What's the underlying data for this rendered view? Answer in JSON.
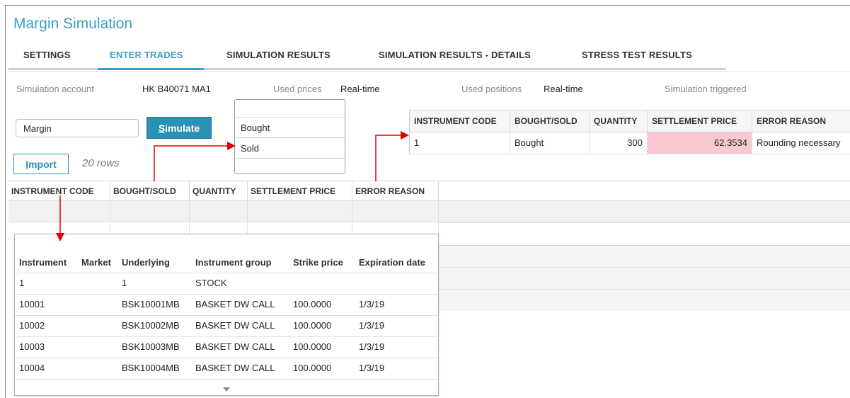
{
  "app": {
    "title": "Margin Simulation"
  },
  "tabs": [
    {
      "label": "SETTINGS"
    },
    {
      "label": "ENTER TRADES"
    },
    {
      "label": "SIMULATION RESULTS"
    },
    {
      "label": "SIMULATION RESULTS - DETAILS"
    },
    {
      "label": "STRESS TEST RESULTS"
    }
  ],
  "info": {
    "account_label": "Simulation account",
    "account_value": "HK B40071 MA1",
    "prices_label": "Used prices",
    "prices_value": "Real-time",
    "positions_label": "Used positions",
    "positions_value": "Real-time",
    "triggered_label": "Simulation triggered"
  },
  "controls": {
    "input_value": "Margin",
    "simulate_label": "Simulate",
    "simulate_mnemonic": "S",
    "simulate_rest": "imulate",
    "import_mnemonic": "I",
    "import_rest": "mport",
    "rows_count": "20 rows"
  },
  "dropdown": {
    "options": [
      "Bought",
      "Sold"
    ]
  },
  "main_grid": {
    "headers": [
      "INSTRUMENT CODE",
      "BOUGHT/SOLD",
      "QUANTITY",
      "SETTLEMENT PRICE",
      "ERROR REASON"
    ]
  },
  "error_table": {
    "headers": [
      "INSTRUMENT CODE",
      "BOUGHT/SOLD",
      "QUANTITY",
      "SETTLEMENT PRICE",
      "ERROR REASON"
    ],
    "row": {
      "instrument": "1",
      "bought_sold": "Bought",
      "quantity": "300",
      "settlement_price": "62.3534",
      "error_reason": "Rounding necessary"
    }
  },
  "instrument_popup": {
    "headers": [
      "Instrument",
      "Market",
      "Underlying",
      "Instrument group",
      "Strike price",
      "Expiration date"
    ],
    "rows": [
      {
        "instrument": "1",
        "market": "",
        "underlying": "1",
        "group": "STOCK",
        "strike": "",
        "expiration": ""
      },
      {
        "instrument": "10001",
        "market": "",
        "underlying": "BSK10001MB",
        "group": "BASKET DW CALL",
        "strike": "100.0000",
        "expiration": "1/3/19"
      },
      {
        "instrument": "10002",
        "market": "",
        "underlying": "BSK10002MB",
        "group": "BASKET DW CALL",
        "strike": "100.0000",
        "expiration": "1/3/19"
      },
      {
        "instrument": "10003",
        "market": "",
        "underlying": "BSK10003MB",
        "group": "BASKET DW CALL",
        "strike": "100.0000",
        "expiration": "1/3/19"
      },
      {
        "instrument": "10004",
        "market": "",
        "underlying": "BSK10004MB",
        "group": "BASKET DW CALL",
        "strike": "100.0000",
        "expiration": "1/3/19"
      }
    ]
  },
  "colors": {
    "accent": "#3aa0c8",
    "button": "#2a91b4",
    "error_highlight": "#f8c9d0",
    "annotation_arrow": "#e00000"
  }
}
